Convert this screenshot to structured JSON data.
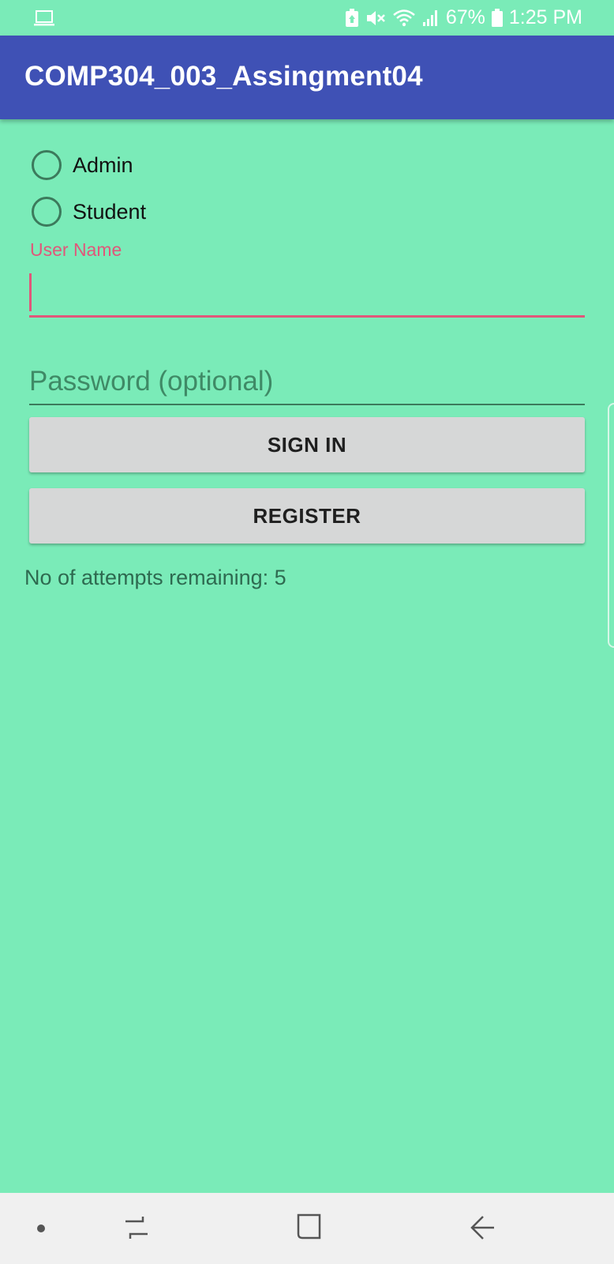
{
  "status_bar": {
    "battery_percent": "67%",
    "time": "1:25 PM",
    "icons": [
      "laptop-icon",
      "battery-saver-icon",
      "mute-icon",
      "wifi-icon",
      "signal-icon",
      "battery-icon"
    ]
  },
  "app_bar": {
    "title": "COMP304_003_Assingment04"
  },
  "role_options": [
    {
      "label": "Admin",
      "selected": false
    },
    {
      "label": "Student",
      "selected": false
    }
  ],
  "form": {
    "username_label": "User Name",
    "username_value": "",
    "password_placeholder": "Password (optional)",
    "sign_in_label": "SIGN IN",
    "register_label": "REGISTER",
    "attempts_text": "No of attempts remaining: 5"
  },
  "colors": {
    "background": "#7aebb8",
    "app_bar": "#3f51b5",
    "accent": "#e0577a",
    "button": "#d6d7d7"
  },
  "nav_bar": {
    "icons": [
      "dot-icon",
      "recents-icon",
      "home-icon",
      "back-icon"
    ]
  }
}
